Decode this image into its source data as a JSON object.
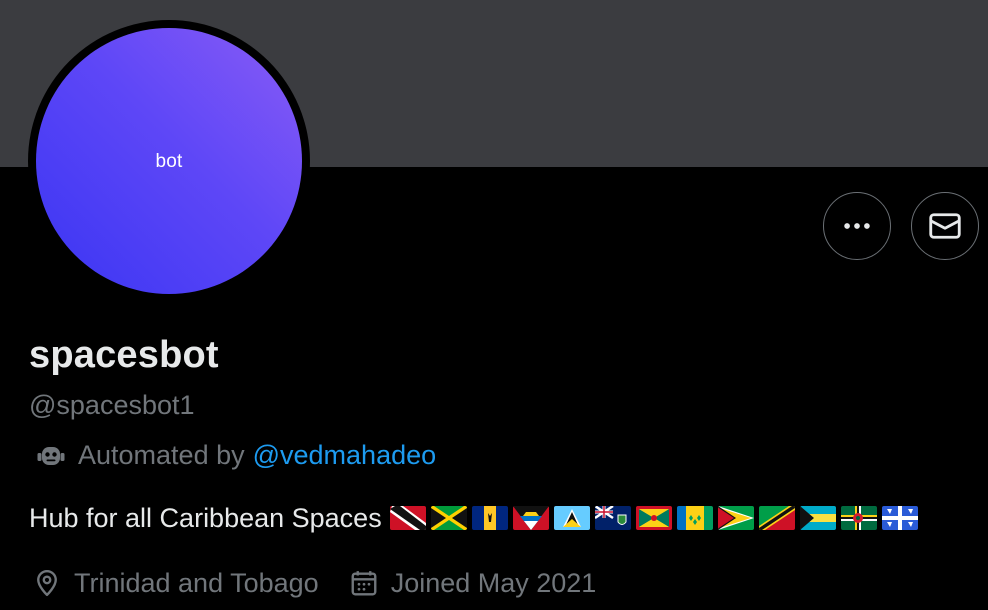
{
  "profile": {
    "avatar_text": "bot",
    "display_name": "spacesbot",
    "handle": "@spacesbot1",
    "automated_prefix": "Automated by",
    "automated_by": "@vedmahadeo",
    "bio": "Hub for all Caribbean Spaces",
    "bio_flags": [
      "trinidad-and-tobago-flag",
      "jamaica-flag",
      "barbados-flag",
      "antigua-and-barbuda-flag",
      "saint-lucia-flag",
      "british-virgin-islands-flag",
      "grenada-flag",
      "saint-vincent-flag",
      "guyana-flag",
      "saint-kitts-and-nevis-flag",
      "bahamas-flag",
      "dominica-flag",
      "martinique-flag"
    ],
    "location": "Trinidad and Tobago",
    "joined": "Joined May 2021"
  },
  "actions": {
    "more_icon": "more-horizontal-icon",
    "message_icon": "envelope-icon"
  },
  "colors": {
    "background": "#000000",
    "banner": "#3b3c40",
    "primary_text": "#e7e9ea",
    "secondary_text": "#71767b",
    "link": "#1d9bf0",
    "avatar_gradient_start": "#8a5cf6",
    "avatar_gradient_end": "#3a35f3"
  }
}
